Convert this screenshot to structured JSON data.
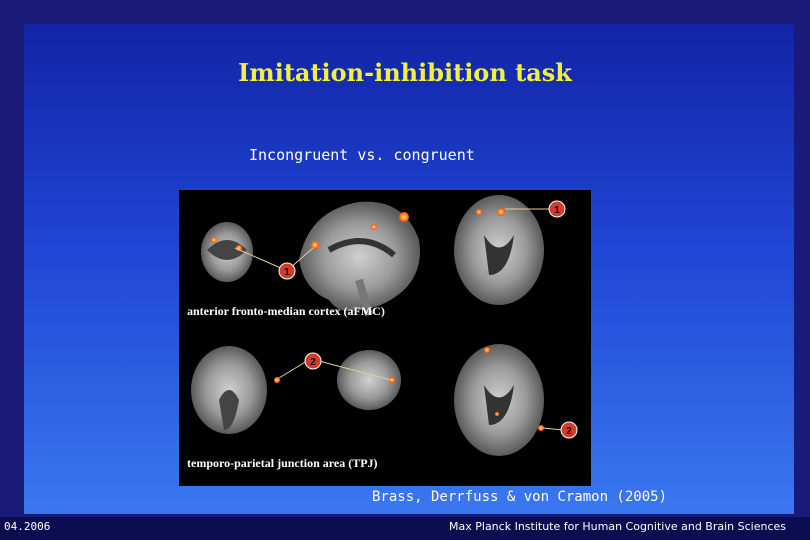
{
  "slide": {
    "title": "Imitation-inhibition task",
    "subtitle": "Incongruent vs. congruent",
    "citation": "Brass, Derrfuss & von Cramon (2005)"
  },
  "figure": {
    "region_1_label": "anterior fronto-median cortex (aFMC)",
    "region_2_label": "temporo-parietal junction area (TPJ)",
    "markers": [
      "1",
      "1",
      "2",
      "2"
    ],
    "activation_color": "#ff6a1a",
    "marker_color": "#d83a2a"
  },
  "footer": {
    "date": "04.2006",
    "institute": "Max Planck Institute for Human Cognitive and Brain Sciences"
  }
}
